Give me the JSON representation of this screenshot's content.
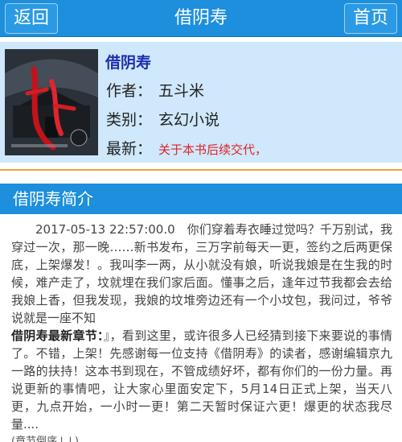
{
  "header": {
    "back_label": "返回",
    "title": "借阴寿",
    "home_label": "首页"
  },
  "book": {
    "title": "借阴寿",
    "author_label": "作者：",
    "author": "五斗米",
    "category_label": "类别：",
    "category": "玄幻小说",
    "latest_label": "最新：",
    "latest": "关于本书后续交代，"
  },
  "intro": {
    "section_title": "借阴寿简介",
    "paragraph": "2017-05-13 22:57:00.0　你们穿着寿衣睡过觉吗？千万别试，我穿过一次，那一晚……新书发布，三万字前每天一更，签约之后两更保底，上架爆发！。我叫李一两，从小就没有娘，听说我娘是在生我的时候，难产走了，坟就埋在我们家后面。懂事之后，逢年过节我都会去给我娘上香，但我发现，我娘的坟堆旁边还有一个小坟包，我问过，爷爷说就是一座不知",
    "latest_chapter_label": "借阴寿最新章节：",
    "latest_chapter_text": "』，看到这里，或许很多人已经猜到接下来要说的事情了。不错，上架！先感谢每一位支持《借阴寿》的读者，感谢编辑京九一路的扶持！这本书到现在，不管成绩好坏，都有你们的一份力量。再说更新的事情吧，让大家心里面安定下，5月14日正式上架，当天八更，九点开始，一小时一更！第二天暂时保证六更！爆更的状态我尽量....",
    "sort_label": "(章节倒序↓↓)"
  }
}
